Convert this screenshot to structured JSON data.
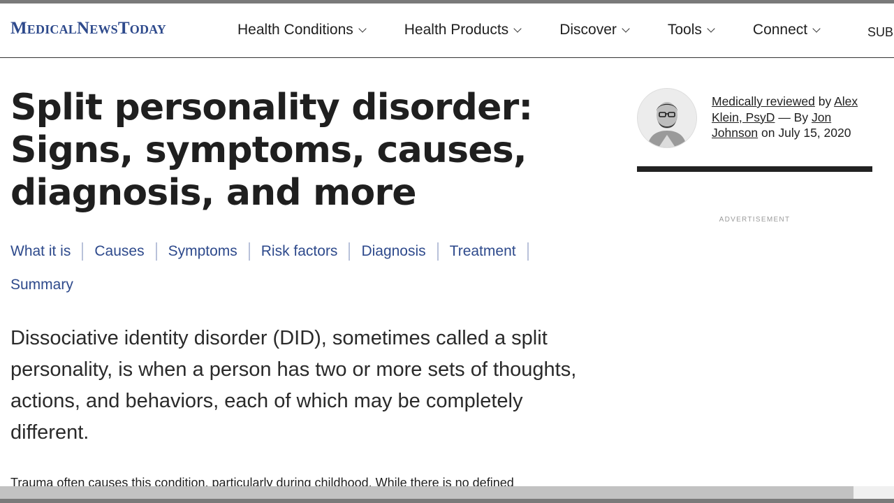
{
  "header": {
    "logo": "MedicalNewsToday",
    "nav": [
      {
        "label": "Health Conditions"
      },
      {
        "label": "Health Products"
      },
      {
        "label": "Discover"
      },
      {
        "label": "Tools"
      },
      {
        "label": "Connect"
      }
    ],
    "subscribe_partial": "SUB"
  },
  "article": {
    "title": "Split personality disorder: Signs, symptoms, causes, diagnosis, and more",
    "toc": [
      {
        "label": "What it is"
      },
      {
        "label": "Causes"
      },
      {
        "label": "Symptoms"
      },
      {
        "label": "Risk factors"
      },
      {
        "label": "Diagnosis"
      },
      {
        "label": "Treatment"
      },
      {
        "label": "Summary"
      }
    ],
    "lead": "Dissociative identity disorder (DID), sometimes called a split personality, is when a person has two or more sets of thoughts, actions, and behaviors, each of which may be completely different.",
    "body_partial": "Trauma often causes this condition, particularly during childhood. While there is no defined"
  },
  "byline": {
    "reviewed_link": "Medically reviewed",
    "by_text": " by ",
    "reviewer": "Alex Klein, PsyD",
    "dash_by": " — By ",
    "author": "Jon Johnson",
    "date_text": " on July 15, 2020"
  },
  "sidebar": {
    "ad_label": "ADVERTISEMENT"
  },
  "colors": {
    "brand": "#2e4a8c",
    "text": "#1f1f1f",
    "toc_separator": "#b9c2da"
  }
}
